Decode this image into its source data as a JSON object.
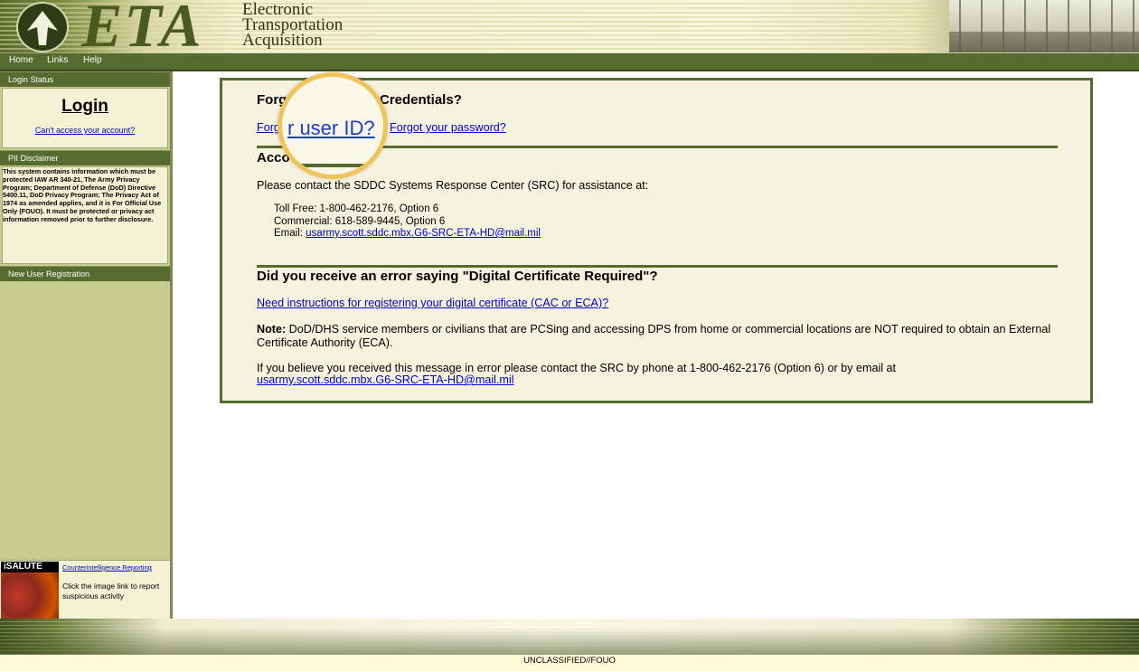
{
  "header": {
    "logo_text": "ETA",
    "subtitle_line1": "Electronic",
    "subtitle_line2": "Transportation",
    "subtitle_line3": "Acquisition"
  },
  "nav": {
    "items": [
      "Home",
      "Links",
      "Help"
    ]
  },
  "sidebar": {
    "login_status_header": "Login Status",
    "login_title": "Login",
    "cant_access": "Can't access your account?",
    "pii_header": "PII Disclaimer",
    "pii_text": "This system contains information which must be protected IAW AR 340-21, The Army Privacy Program; Department of Defense (DoD) Directive 5400.11, DoD Privacy Program; The Privacy Act of 1974 as amended applies, and it is For Official Use Only (FOUO). It must be protected or privacy act information removed prior to further disclosure.",
    "new_user_header": "New User Registration",
    "salute_tag": "iSALUTE",
    "ci_link": "Counterintelligence Reporting",
    "ci_text": "Click the image link to report suspicious activity"
  },
  "main": {
    "forgot_heading_left": "Forg",
    "forgot_heading_right": "Credentials?",
    "forgot_user_left": "Forgo",
    "forgot_password": "Forgot your password?",
    "account_heading": "Acco",
    "contact_intro": "Please contact the SDDC Systems Response Center (SRC) for assistance at:",
    "toll_free": "Toll Free: 1-800-462-2176, Option 6",
    "commercial": "Commercial: 618-589-9445, Option 6",
    "email_label": "Email: ",
    "email": "usarmy.scott.sddc.mbx.G6-SRC-ETA-HD@mail.mil",
    "cert_heading": "Did you receive an error saying \"Digital Certificate Required\"?",
    "cert_link": "Need instructions for registering your digital certificate (CAC or ECA)?",
    "note_label": "Note:",
    "note_text": " DoD/DHS service members or civilians that are PCSing and accessing DPS from home or commercial locations are NOT required to obtain an External Certificate Authority (ECA).",
    "error_text": "If you believe you received this message in error please contact the SRC by phone at 1-800-462-2176 (Option 6) or by email at",
    "error_email": "usarmy.scott.sddc.mbx.G6-SRC-ETA-HD@mail.mil",
    "magnifier_text": "r user ID?"
  },
  "footer": {
    "classification": "UNCLASSIFIED//FOUO"
  },
  "colors": {
    "olive": "#556b2f",
    "sidebar_bg": "#c6cc8f",
    "panel_bg": "#f5f3dd",
    "link": "#0000cc",
    "magnifier_ring": "#f0c35b"
  }
}
